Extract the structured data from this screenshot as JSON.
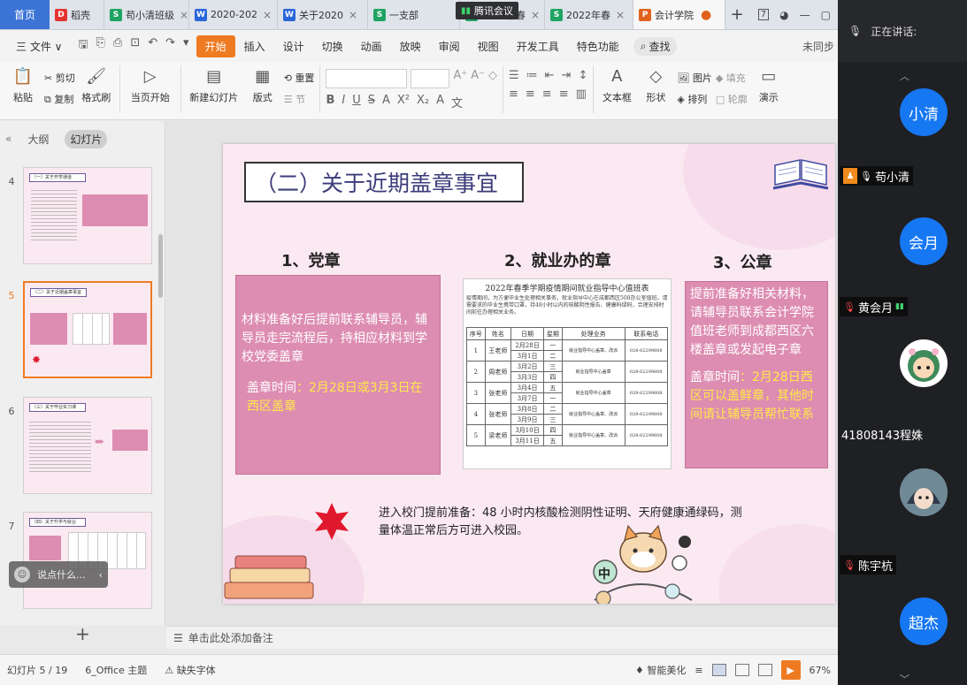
{
  "tabs": {
    "home": "首页",
    "items": [
      {
        "label": "稻壳",
        "icon": "D",
        "color": "#e3342f",
        "active": false,
        "close": false
      },
      {
        "label": "苟小清班级",
        "icon": "S",
        "color": "#1fa463",
        "active": false,
        "close": true
      },
      {
        "label": "2020-202",
        "icon": "W",
        "color": "#2b66d9",
        "active": false,
        "close": true
      },
      {
        "label": "关于2020",
        "icon": "W",
        "color": "#2b66d9",
        "active": false,
        "close": true
      },
      {
        "label": "一支部",
        "icon": "S",
        "color": "#1fa463",
        "active": false,
        "close": false
      },
      {
        "label": "2022年春",
        "icon": "S",
        "color": "#1fa463",
        "active": false,
        "close": true
      },
      {
        "label": "2022年春",
        "icon": "S",
        "color": "#1fa463",
        "active": false,
        "close": true
      },
      {
        "label": "会计学院",
        "icon": "P",
        "color": "#e1621f",
        "active": true,
        "close": false
      }
    ],
    "meeting_badge": "腾讯会议",
    "window_count": "7"
  },
  "menu": {
    "file": "三 文件 ∨",
    "items": [
      "开始",
      "插入",
      "设计",
      "切换",
      "动画",
      "放映",
      "审阅",
      "视图",
      "开发工具",
      "特色功能"
    ],
    "active": "开始",
    "search": "查找",
    "sync": "未同步"
  },
  "ribbon": {
    "paste": "粘贴",
    "cut": "剪切",
    "copy": "复制",
    "format_painter": "格式刷",
    "play_current": "当页开始",
    "new_slide": "新建幻灯片",
    "layout": "版式",
    "reset": "重置",
    "section": "节",
    "textbox": "文本框",
    "shape": "形状",
    "arrange": "排列",
    "picture": "图片",
    "fill": "填充",
    "outline": "轮廓",
    "present": "演示"
  },
  "left_panel": {
    "tab_outline": "大纲",
    "tab_slides": "幻灯片",
    "slides": [
      {
        "num": "4",
        "title": "（一）关于开学通道",
        "current": false
      },
      {
        "num": "5",
        "title": "（二）关于近期盖章事宜",
        "current": true
      },
      {
        "num": "6",
        "title": "（三）关于毕业实习课",
        "current": false
      },
      {
        "num": "7",
        "title": "（四）关于升学与就业",
        "current": false
      }
    ],
    "chat_placeholder": "说点什么..."
  },
  "slide": {
    "title": "（二）关于近期盖章事宜",
    "col1": {
      "head": "1、党章",
      "text": "材料准备好后提前联系辅导员，辅导员走完流程后，持相应材料到学校党委盖章",
      "time_label": "盖章时间",
      "time_value": "：2月28日或3月3日在西区盖章"
    },
    "col2": {
      "head": "2、就业办的章",
      "doc_title": "2022年春季学期疫情期间就业指导中心值班表",
      "doc_body": "疫情期间，为方便毕业生处理相关事务，就业指导中心在成都西区508办公室值班。请需要求的毕业生携带口罩，持48小时以内的核酸阴性报告、健康码绿码，合理安排时间前往办理相关业务。",
      "headers": [
        "序号",
        "姓名",
        "日期",
        "星期",
        "处理业务",
        "联系电话"
      ],
      "rows": [
        [
          "1",
          "王老师",
          "2月28日",
          "一",
          "就业指导中心盖章、改派",
          "028-62299808"
        ],
        [
          "",
          "",
          "3月1日",
          "二",
          "",
          ""
        ],
        [
          "2",
          "周老师",
          "3月2日",
          "三",
          "就业指导中心盖章",
          "028-62299808"
        ],
        [
          "",
          "",
          "3月3日",
          "四",
          "",
          ""
        ],
        [
          "3",
          "张老师",
          "3月4日",
          "五",
          "就业指导中心盖章",
          "028-62299808"
        ],
        [
          "",
          "",
          "3月7日",
          "一",
          "",
          ""
        ],
        [
          "4",
          "张老师",
          "3月8日",
          "二",
          "就业指导中心盖章、改派",
          "028-62299808"
        ],
        [
          "",
          "",
          "3月9日",
          "三",
          "",
          ""
        ],
        [
          "5",
          "梁老师",
          "3月10日",
          "四",
          "就业指导中心盖章、改派",
          "028-62299808"
        ],
        [
          "",
          "",
          "3月11日",
          "五",
          "",
          ""
        ]
      ]
    },
    "col3": {
      "head": "3、公章",
      "text": "提前准备好相关材料，请辅导员联系会计学院值班老师到成都西区六楼盖章或发起电子章",
      "time_label": "盖章时间",
      "time_value": "：2月28日西区可以盖鲜章，其他时间请让辅导员帮忙联系"
    },
    "note": "进入校门提前准备：48 小时内核酸检测阴性证明、天府健康通绿码，测量体温正常后方可进入校园。",
    "cat_sign": "中"
  },
  "notes_placeholder": "单击此处添加备注",
  "status": {
    "slide_count": "幻灯片 5 / 19",
    "theme": "6_Office 主题",
    "missing_font": "缺失字体",
    "smart": "智能美化",
    "zoom": "67%"
  },
  "meeting": {
    "speaking_label": "正在讲话:",
    "participants": [
      {
        "avatar_text": "小清",
        "name": "苟小清",
        "type": "blue"
      },
      {
        "avatar_text": "会月",
        "name": "黄会月",
        "type": "blue"
      },
      {
        "avatar_text": "",
        "name": "41808143程姝",
        "type": "photo1"
      },
      {
        "avatar_text": "",
        "name": "陈宇杭",
        "type": "photo2"
      },
      {
        "avatar_text": "超杰",
        "name": "",
        "type": "blue"
      }
    ]
  },
  "colors": {
    "accent_orange": "#ee7b22",
    "slide_pink": "#dd8db1",
    "highlight_yellow": "#ffe94a",
    "meeting_blue": "#1677f2"
  }
}
